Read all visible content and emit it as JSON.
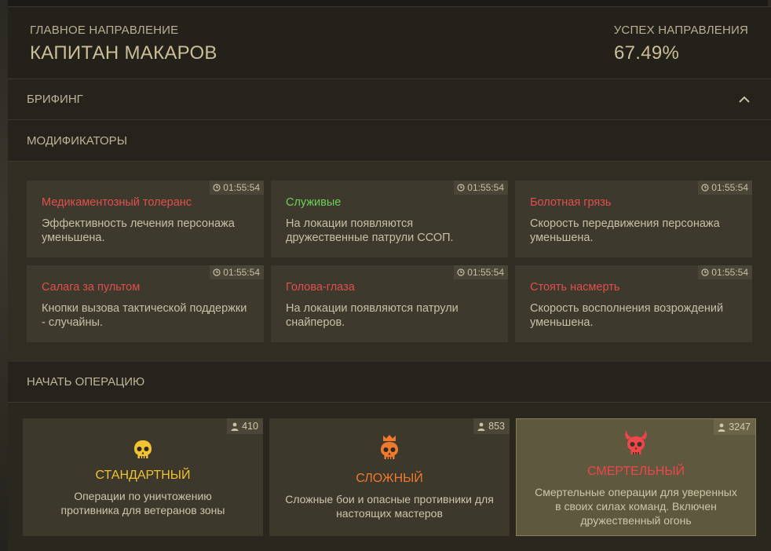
{
  "header": {
    "main_label": "ГЛАВНОЕ НАПРАВЛЕНИЕ",
    "main_value": "КАПИТАН МАКАРОВ",
    "success_label": "УСПЕХ НАПРАВЛЕНИЯ",
    "success_value": "67.49%"
  },
  "briefing": {
    "title": "БРИФИНГ",
    "icon": "chevron-up-icon"
  },
  "modifiers": {
    "title": "МОДИФИКАТОРЫ",
    "items": [
      {
        "title": "Медикаментозный толеранс",
        "desc": "Эффективность лечения персонажа уменьшена.",
        "timer": "01:55:54",
        "color": "#e0504e"
      },
      {
        "title": "Служивые",
        "desc": "На локации появляются дружественные патрули ССОП.",
        "timer": "01:55:54",
        "color": "#6ccf5a"
      },
      {
        "title": "Болотная грязь",
        "desc": "Скорость передвижения персонажа уменьшена.",
        "timer": "01:55:54",
        "color": "#e0504e"
      },
      {
        "title": "Салага за пультом",
        "desc": "Кнопки вызова тактической поддержки - случайны.",
        "timer": "01:55:54",
        "color": "#e0504e"
      },
      {
        "title": "Голова-глаза",
        "desc": "На локации появляются патрули снайперов.",
        "timer": "01:55:54",
        "color": "#e0504e"
      },
      {
        "title": "Стоять насмерть",
        "desc": "Скорость восполнения возрождений уменьшена.",
        "timer": "01:55:54",
        "color": "#e0504e"
      }
    ]
  },
  "operations": {
    "title": "НАЧАТЬ ОПЕРАЦИЮ",
    "items": [
      {
        "name": "СТАНДАРТНЫЙ",
        "desc": "Операции по уничтожению противника для ветеранов зоны",
        "players": "410",
        "color": "#f1c232",
        "icon": "skull-icon"
      },
      {
        "name": "СЛОЖНЫЙ",
        "desc": "Сложные бои и опасные противники для настоящих мастеров",
        "players": "853",
        "color": "#ef7a2d",
        "icon": "crowned-skull-icon"
      },
      {
        "name": "СМЕРТЕЛЬНЫЙ",
        "desc": "Смертельные операции для уверенных в своих силах команд. Включен дружественный огонь",
        "players": "3247",
        "color": "#f0454a",
        "icon": "horned-skull-icon"
      }
    ]
  }
}
